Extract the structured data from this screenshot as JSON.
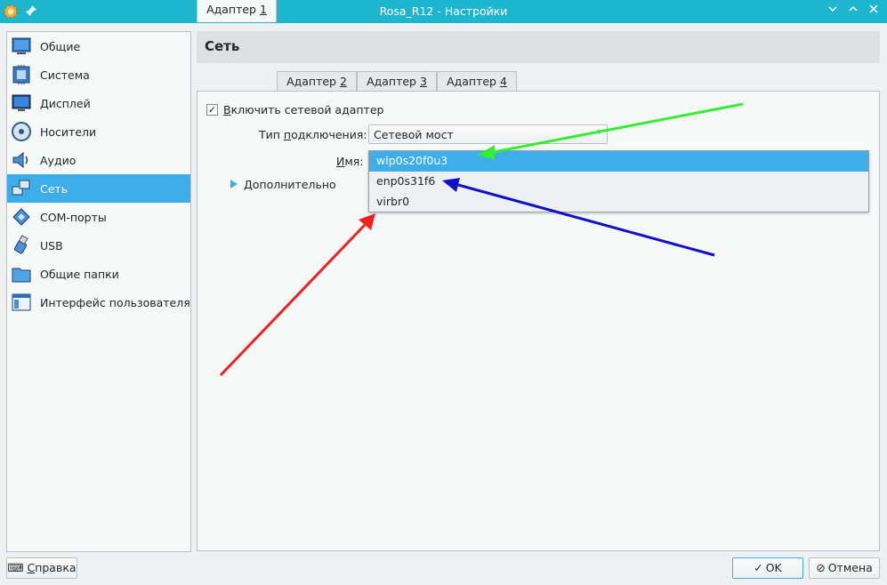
{
  "window": {
    "title": "Rosa_R12 - Настройки",
    "icons": {
      "app": "gear-icon",
      "pin": "pin-icon",
      "minimize": "chevron-down-icon",
      "maximize": "chevron-up-icon",
      "close": "close-icon"
    }
  },
  "sidebar": {
    "items": [
      {
        "label": "Общие",
        "icon": "general-icon"
      },
      {
        "label": "Система",
        "icon": "system-icon"
      },
      {
        "label": "Дисплей",
        "icon": "display-icon"
      },
      {
        "label": "Носители",
        "icon": "storage-icon"
      },
      {
        "label": "Аудио",
        "icon": "audio-icon"
      },
      {
        "label": "Сеть",
        "icon": "network-icon",
        "selected": true
      },
      {
        "label": "COM-порты",
        "icon": "serial-port-icon"
      },
      {
        "label": "USB",
        "icon": "usb-icon"
      },
      {
        "label": "Общие папки",
        "icon": "shared-folder-icon"
      },
      {
        "label": "Интерфейс пользователя",
        "icon": "user-interface-icon"
      }
    ]
  },
  "main": {
    "title": "Сеть",
    "tabs": [
      {
        "prefix": "Адаптер ",
        "num": "1"
      },
      {
        "prefix": "Адаптер ",
        "num": "2"
      },
      {
        "prefix": "Адаптер ",
        "num": "3"
      },
      {
        "prefix": "Адаптер ",
        "num": "4"
      }
    ],
    "enable_adapter": {
      "checked": true,
      "label_first": "В",
      "label_rest": "ключить сетевой адаптер"
    },
    "connection_type": {
      "label_a": "Тип ",
      "label_u": "п",
      "label_b": "одключения:",
      "value": "Сетевой мост"
    },
    "name": {
      "label_u": "И",
      "label_rest": "мя:",
      "options": [
        "wlp0s20f0u3",
        "enp0s31f6",
        "virbr0"
      ],
      "selected_index": 0
    },
    "advanced": {
      "label_u": "Д",
      "label_rest": "ополнительно"
    }
  },
  "footer": {
    "help": {
      "label_u": "С",
      "label_rest": "правка"
    },
    "ok": {
      "label": "OK",
      "glyph": "✓"
    },
    "cancel": {
      "label": "Отмена",
      "glyph": "⊘"
    }
  },
  "annotations": {
    "arrow_colors": {
      "green": "#33ee33",
      "blue": "#1010cc",
      "red": "#ee2222"
    }
  },
  "colors": {
    "accent": "#3daee9",
    "titlebar": "#1eb6cf"
  }
}
